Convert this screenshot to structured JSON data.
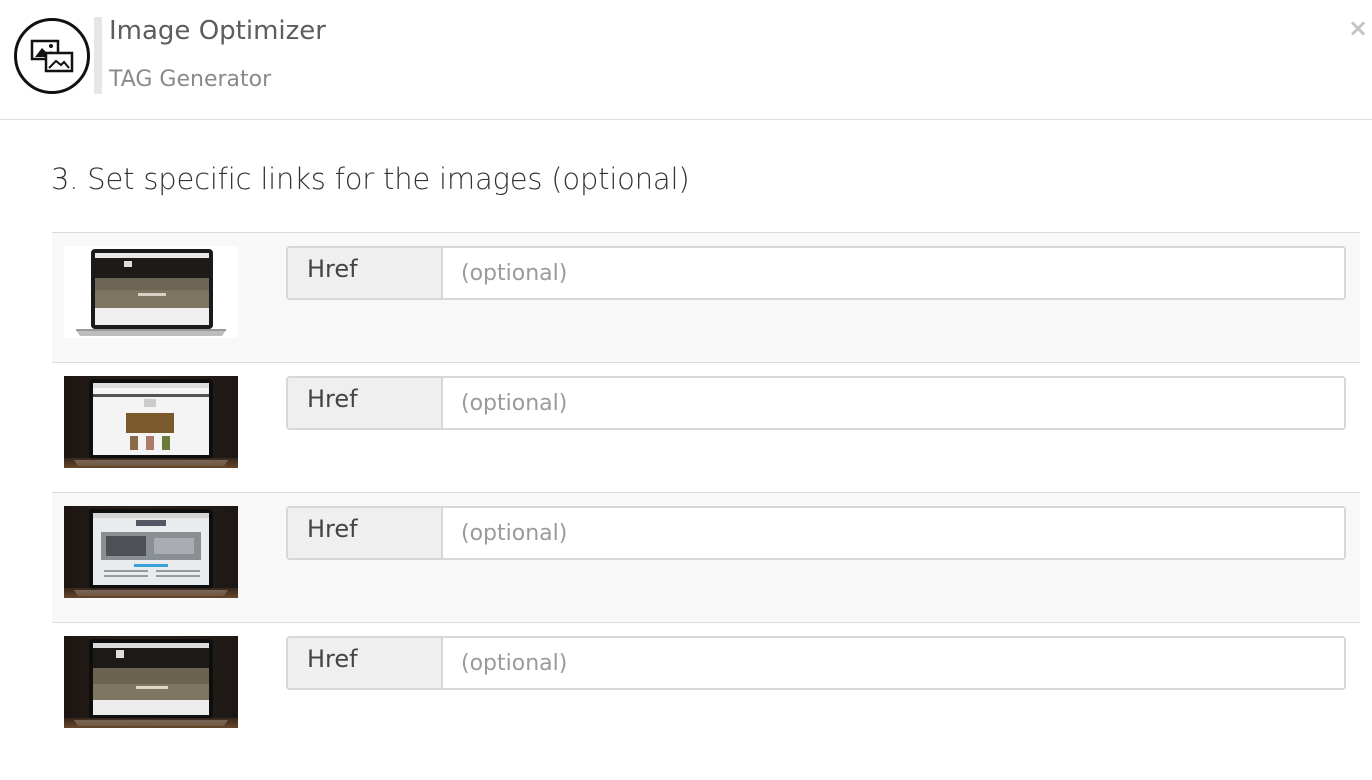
{
  "header": {
    "title": "Image Optimizer",
    "subtitle": "TAG Generator",
    "close_label": "×",
    "logo_icon": "image-stack-icon"
  },
  "section": {
    "heading": "3. Set specific links for the images (optional)"
  },
  "rows": [
    {
      "addon_label": "Href",
      "value": "",
      "placeholder": "(optional)",
      "thumbnail": "laptop-website-preview-1"
    },
    {
      "addon_label": "Href",
      "value": "",
      "placeholder": "(optional)",
      "thumbnail": "laptop-website-preview-2"
    },
    {
      "addon_label": "Href",
      "value": "",
      "placeholder": "(optional)",
      "thumbnail": "laptop-website-preview-3"
    },
    {
      "addon_label": "Href",
      "value": "",
      "placeholder": "(optional)",
      "thumbnail": "laptop-website-preview-4"
    }
  ],
  "colors": {
    "border": "#dcdcdc",
    "row_alt_bg": "#f8f8f8",
    "addon_bg": "#efefef",
    "placeholder": "#9a9a9a"
  }
}
